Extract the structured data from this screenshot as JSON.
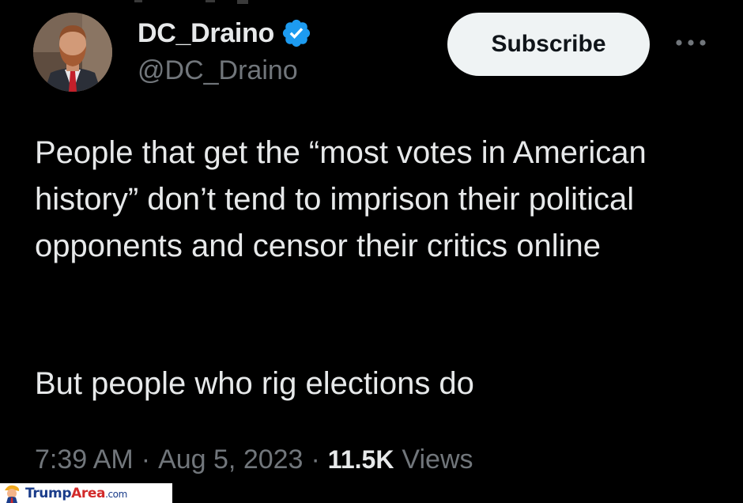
{
  "author": {
    "display_name": "DC_Draino",
    "handle": "@DC_Draino",
    "verified": true,
    "verified_color": "#1d9bf0",
    "avatar_icon": "avatar-photo"
  },
  "actions": {
    "subscribe_label": "Subscribe",
    "more_icon": "more-horizontal-icon"
  },
  "tweet": {
    "text_paragraph_1": "People that get the “most votes in American history” don’t tend to imprison their political opponents and censor their critics online",
    "text_paragraph_2": "But people who rig elections do"
  },
  "meta": {
    "time": "7:39 AM",
    "separator": "·",
    "date": "Aug 5, 2023",
    "views_count": "11.5K",
    "views_label": "Views"
  },
  "watermark": {
    "brand_part_1": "Trump",
    "brand_part_2": "Area",
    "brand_domain": ".com"
  },
  "colors": {
    "background": "#000000",
    "primary_text": "#e7e9ea",
    "secondary_text": "#71767b",
    "button_bg": "#eff3f4"
  }
}
